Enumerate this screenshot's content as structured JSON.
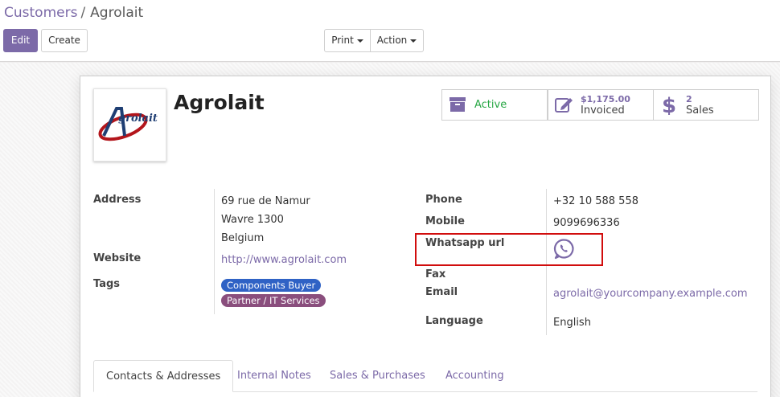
{
  "breadcrumb": {
    "parent": "Customers",
    "separator": "/",
    "current": "Agrolait"
  },
  "toolbar": {
    "edit_label": "Edit",
    "create_label": "Create",
    "print_label": "Print",
    "action_label": "Action"
  },
  "record": {
    "name": "Agrolait",
    "logo_text": "Agrolait"
  },
  "stats": {
    "active_label": "Active",
    "invoiced_value": "$1,175.00",
    "invoiced_label": "Invoiced",
    "sales_value": "2",
    "sales_label": "Sales"
  },
  "fields": {
    "address_label": "Address",
    "address_line1": "69 rue de Namur",
    "address_line2": "Wavre 1300",
    "address_line3": "Belgium",
    "website_label": "Website",
    "website_value": "http://www.agrolait.com",
    "tags_label": "Tags",
    "tags": [
      "Components Buyer",
      "Partner / IT Services"
    ],
    "phone_label": "Phone",
    "phone_value": "+32 10 588 558",
    "mobile_label": "Mobile",
    "mobile_value": "9099696336",
    "whatsapp_label": "Whatsapp url",
    "fax_label": "Fax",
    "email_label": "Email",
    "email_value": "agrolait@yourcompany.example.com",
    "language_label": "Language",
    "language_value": "English"
  },
  "tabs": [
    "Contacts & Addresses",
    "Internal Notes",
    "Sales & Purchases",
    "Accounting"
  ],
  "colors": {
    "accent": "#7c6aa8",
    "active_green": "#28a745",
    "tag_blue": "#2f62c5",
    "tag_purple": "#8a4e7d",
    "highlight_red": "#d10d0d"
  }
}
